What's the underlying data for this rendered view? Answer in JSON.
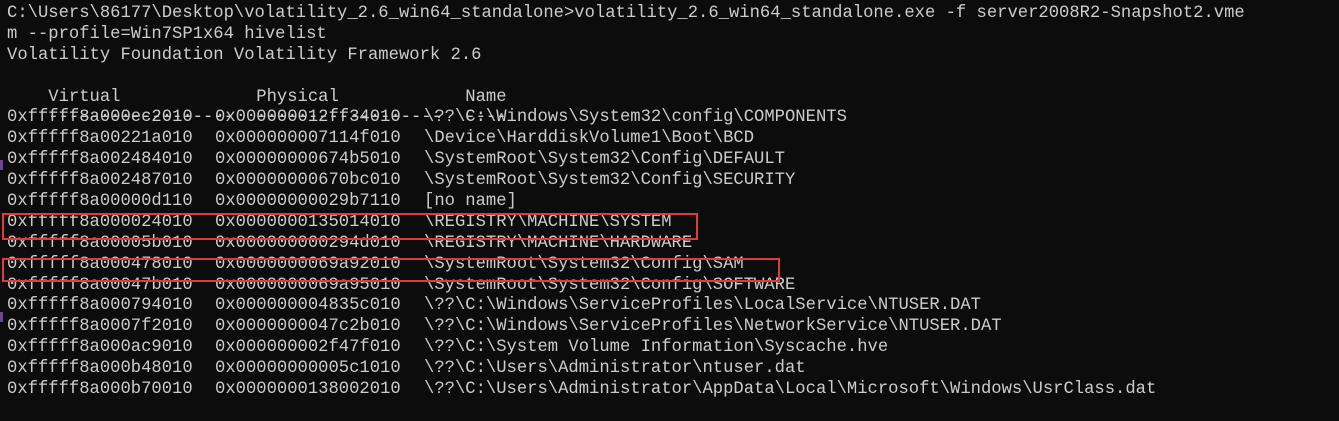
{
  "console": {
    "command_line_1": "C:\\Users\\86177\\Desktop\\volatility_2.6_win64_standalone>volatility_2.6_win64_standalone.exe -f server2008R2-Snapshot2.vme",
    "command_line_2": "m --profile=Win7SP1x64 hivelist",
    "banner": "Volatility Foundation Volatility Framework 2.6",
    "header": {
      "virtual": "Virtual",
      "physical": "Physical",
      "name": "Name"
    },
    "separator": {
      "virtual": "------------------",
      "physical": "------------------",
      "name": "----"
    },
    "rows": [
      {
        "virtual": "0xfffff8a000ec2010",
        "physical": "0x000000012ff34010",
        "name": "\\??\\C:\\Windows\\System32\\config\\COMPONENTS"
      },
      {
        "virtual": "0xfffff8a00221a010",
        "physical": "0x000000007114f010",
        "name": "\\Device\\HarddiskVolume1\\Boot\\BCD"
      },
      {
        "virtual": "0xfffff8a002484010",
        "physical": "0x00000000674b5010",
        "name": "\\SystemRoot\\System32\\Config\\DEFAULT"
      },
      {
        "virtual": "0xfffff8a002487010",
        "physical": "0x00000000670bc010",
        "name": "\\SystemRoot\\System32\\Config\\SECURITY"
      },
      {
        "virtual": "0xfffff8a00000d110",
        "physical": "0x00000000029b7110",
        "name": "[no name]"
      },
      {
        "virtual": "0xfffff8a000024010",
        "physical": "0x0000000135014010",
        "name": "\\REGISTRY\\MACHINE\\SYSTEM"
      },
      {
        "virtual": "0xfffff8a00005b010",
        "physical": "0x000000000294d010",
        "name": "\\REGISTRY\\MACHINE\\HARDWARE"
      },
      {
        "virtual": "0xfffff8a000478010",
        "physical": "0x0000000069a92010",
        "name": "\\SystemRoot\\System32\\Config\\SAM"
      },
      {
        "virtual": "0xfffff8a00047b010",
        "physical": "0x0000000069a95010",
        "name": "\\SystemRoot\\System32\\Config\\SOFTWARE"
      },
      {
        "virtual": "0xfffff8a000794010",
        "physical": "0x000000004835c010",
        "name": "\\??\\C:\\Windows\\ServiceProfiles\\LocalService\\NTUSER.DAT"
      },
      {
        "virtual": "0xfffff8a0007f2010",
        "physical": "0x0000000047c2b010",
        "name": "\\??\\C:\\Windows\\ServiceProfiles\\NetworkService\\NTUSER.DAT"
      },
      {
        "virtual": "0xfffff8a000ac9010",
        "physical": "0x000000002f47f010",
        "name": "\\??\\C:\\System Volume Information\\Syscache.hve"
      },
      {
        "virtual": "0xfffff8a000b48010",
        "physical": "0x00000000005c1010",
        "name": "\\??\\C:\\Users\\Administrator\\ntuser.dat"
      },
      {
        "virtual": "0xfffff8a000b70010",
        "physical": "0x0000000138002010",
        "name": "\\??\\C:\\Users\\Administrator\\AppData\\Local\\Microsoft\\Windows\\UsrClass.dat"
      }
    ],
    "colors": {
      "background": "#0c0c0c",
      "text": "#cccccc",
      "highlight_box": "#e03a3a"
    }
  }
}
